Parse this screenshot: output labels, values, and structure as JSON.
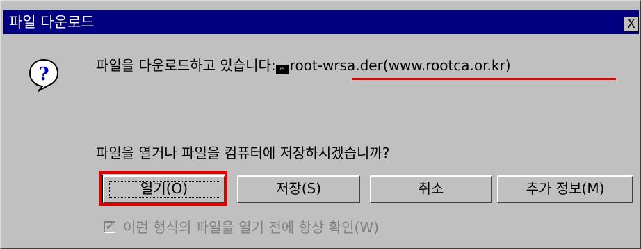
{
  "dialog": {
    "title": "파일 다운로드",
    "close_symbol": "X"
  },
  "message": {
    "prefix": "파일을 다운로드하고 있습니다:",
    "file_icon": "file-icon",
    "filename": "root-wrsa.der(www.rootca.or.kr)"
  },
  "question": "파일을 열거나 파일을 컴퓨터에 저장하시겠습니까?",
  "buttons": {
    "open": "열기(O)",
    "save": "저장(S)",
    "cancel": "취소",
    "more_info": "추가 정보(M)"
  },
  "checkbox": {
    "checked": true,
    "label": "이런 형식의 파일을 열기 전에 항상 확인(W)"
  },
  "colors": {
    "titlebar": "#000080",
    "window": "#c0c0c0",
    "highlight_red": "#e00000"
  }
}
